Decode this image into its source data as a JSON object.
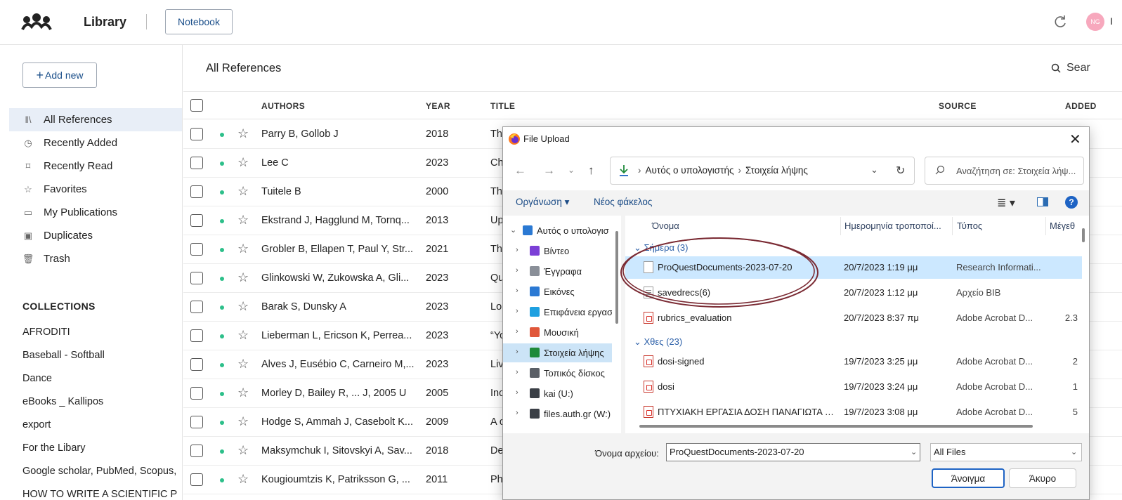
{
  "app": {
    "title": "Library",
    "notebook_label": "Notebook",
    "avatar_initials": "NG",
    "avatar_name_fragment": "I",
    "logo_icon": "mendeley-logo-icon",
    "sync_icon": "refresh-icon"
  },
  "sidebar": {
    "add_new_label": "Add new",
    "add_new_plus": "+",
    "nav": [
      {
        "label": "All References",
        "icon": "library-icon",
        "glyph": "‖\\",
        "active": true
      },
      {
        "label": "Recently Added",
        "icon": "clock-icon",
        "glyph": "◷"
      },
      {
        "label": "Recently Read",
        "icon": "bookmark-icon",
        "glyph": "⌑"
      },
      {
        "label": "Favorites",
        "icon": "star-icon",
        "glyph": "☆"
      },
      {
        "label": "My Publications",
        "icon": "document-icon",
        "glyph": "▭"
      },
      {
        "label": "Duplicates",
        "icon": "duplicate-icon",
        "glyph": "▣"
      },
      {
        "label": "Trash",
        "icon": "trash-icon",
        "glyph": "🗑"
      }
    ],
    "collections_heading": "COLLECTIONS",
    "collections": [
      "AFRODITI",
      "Baseball - Softball",
      "Dance",
      "eBooks _ Kallipos",
      "export",
      "For the Libary",
      "Google scholar, PubMed, Scopus,",
      "HOW TO WRITE A SCIENTIFIC P"
    ]
  },
  "main": {
    "title": "All References",
    "search_label": "Sear",
    "columns": {
      "authors": "AUTHORS",
      "year": "YEAR",
      "title": "TITLE",
      "source": "SOURCE",
      "added": "ADDED"
    },
    "rows": [
      {
        "authors": "Parry B, Gollob J",
        "year": "2018",
        "title": "The"
      },
      {
        "authors": "Lee C",
        "year": "2023",
        "title": "Ch"
      },
      {
        "authors": "Tuitele B",
        "year": "2000",
        "title": "The"
      },
      {
        "authors": "Ekstrand J, Hagglund M, Tornq...",
        "year": "2013",
        "title": "Up"
      },
      {
        "authors": "Grobler B, Ellapen T, Paul Y, Str...",
        "year": "2021",
        "title": "The"
      },
      {
        "authors": "Glinkowski W, Żukowska A, Gli...",
        "year": "2023",
        "title": "Qu"
      },
      {
        "authors": "Barak S, Dunsky A",
        "year": "2023",
        "title": "Lor"
      },
      {
        "authors": "Lieberman L, Ericson K, Perrea...",
        "year": "2023",
        "title": "“Yo"
      },
      {
        "authors": "Alves J, Eusébio C, Carneiro M,...",
        "year": "2023",
        "title": "Liv"
      },
      {
        "authors": "Morley D, Bailey R, ... J, 2005 U",
        "year": "2005",
        "title": "Inc"
      },
      {
        "authors": "Hodge S, Ammah J, Casebolt K...",
        "year": "2009",
        "title": "A c"
      },
      {
        "authors": "Maksymchuk I, Sitovskyi A, Sav...",
        "year": "2018",
        "title": "De"
      },
      {
        "authors": "Kougioumtzis K, Patriksson G, ...",
        "year": "2011",
        "title": "Ph"
      }
    ]
  },
  "dialog": {
    "title": "File Upload",
    "close": "✕",
    "nav": {
      "back": "←",
      "forward": "→",
      "recent": "⌄",
      "up": "↑"
    },
    "address": [
      "Αυτός ο υπολογιστής",
      "Στοιχεία λήψης"
    ],
    "address_sep": "›",
    "search_placeholder": "Αναζήτηση σε: Στοιχεία λήψ...",
    "organize": "Οργάνωση ▾",
    "new_folder": "Νέος φάκελος",
    "view_glyph": "≣ ▾",
    "help": "?",
    "tree": [
      {
        "label": "Αυτός ο υπολογισ",
        "icon": "computer-icon",
        "root": true,
        "chev": "⌄"
      },
      {
        "label": "Βίντεο",
        "icon": "video-folder-icon",
        "chev": "›"
      },
      {
        "label": "Έγγραφα",
        "icon": "documents-folder-icon",
        "chev": "›"
      },
      {
        "label": "Εικόνες",
        "icon": "pictures-folder-icon",
        "chev": "›"
      },
      {
        "label": "Επιφάνεια εργασ",
        "icon": "desktop-folder-icon",
        "chev": "›"
      },
      {
        "label": "Μουσική",
        "icon": "music-folder-icon",
        "chev": "›"
      },
      {
        "label": "Στοιχεία λήψης",
        "icon": "downloads-folder-icon",
        "chev": "›",
        "selected": true
      },
      {
        "label": "Τοπικός δίσκος",
        "icon": "local-disk-icon",
        "chev": "›"
      },
      {
        "label": "kai (U:)",
        "icon": "network-drive-icon",
        "chev": "›"
      },
      {
        "label": "files.auth.gr (W:)",
        "icon": "network-drive-icon",
        "chev": "›"
      }
    ],
    "columns": {
      "name": "Όνομα",
      "date": "Ημερομηνία τροποποί...",
      "type": "Τύπος",
      "size": "Μέγεθ"
    },
    "groups": [
      {
        "label": "Σήμερα (3)",
        "files": [
          {
            "name": "ProQuestDocuments-2023-07-20",
            "date": "20/7/2023 1:19 μμ",
            "type": "Research Informati...",
            "size": "",
            "icon": "file-icon",
            "selected": true
          },
          {
            "name": "savedrecs(6)",
            "date": "20/7/2023 1:12 μμ",
            "type": "Αρχείο BIB",
            "size": "",
            "icon": "bib-file-icon"
          },
          {
            "name": "rubrics_evaluation",
            "date": "20/7/2023 8:37 πμ",
            "type": "Adobe Acrobat D...",
            "size": "2.3",
            "icon": "pdf-file-icon"
          }
        ]
      },
      {
        "label": "Χθες (23)",
        "files": [
          {
            "name": "dosi-signed",
            "date": "19/7/2023 3:25 μμ",
            "type": "Adobe Acrobat D...",
            "size": "2",
            "icon": "pdf-file-icon"
          },
          {
            "name": "dosi",
            "date": "19/7/2023 3:24 μμ",
            "type": "Adobe Acrobat D...",
            "size": "1",
            "icon": "pdf-file-icon"
          },
          {
            "name": "ΠΤΥΧΙΑΚΗ ΕΡΓΑΣΙΑ ΔΟΣΗ ΠΑΝΑΓΙΩΤΑ Ι...",
            "date": "19/7/2023 3:08 μμ",
            "type": "Adobe Acrobat D...",
            "size": "5",
            "icon": "pdf-file-icon"
          }
        ]
      }
    ],
    "filename_label": "Όνομα αρχείου:",
    "filename_value": "ProQuestDocuments-2023-07-20",
    "filter_value": "All Files",
    "open_label": "Άνοιγμα",
    "cancel_label": "Άκυρο"
  },
  "colors": {
    "accent_blue": "#1e63c4",
    "link_blue": "#1b4f8a",
    "status_green": "#2dbf8a",
    "selected_row": "#cce8ff",
    "sidebar_active": "#e8eef7",
    "annotation_ellipse": "#7a2a33"
  }
}
